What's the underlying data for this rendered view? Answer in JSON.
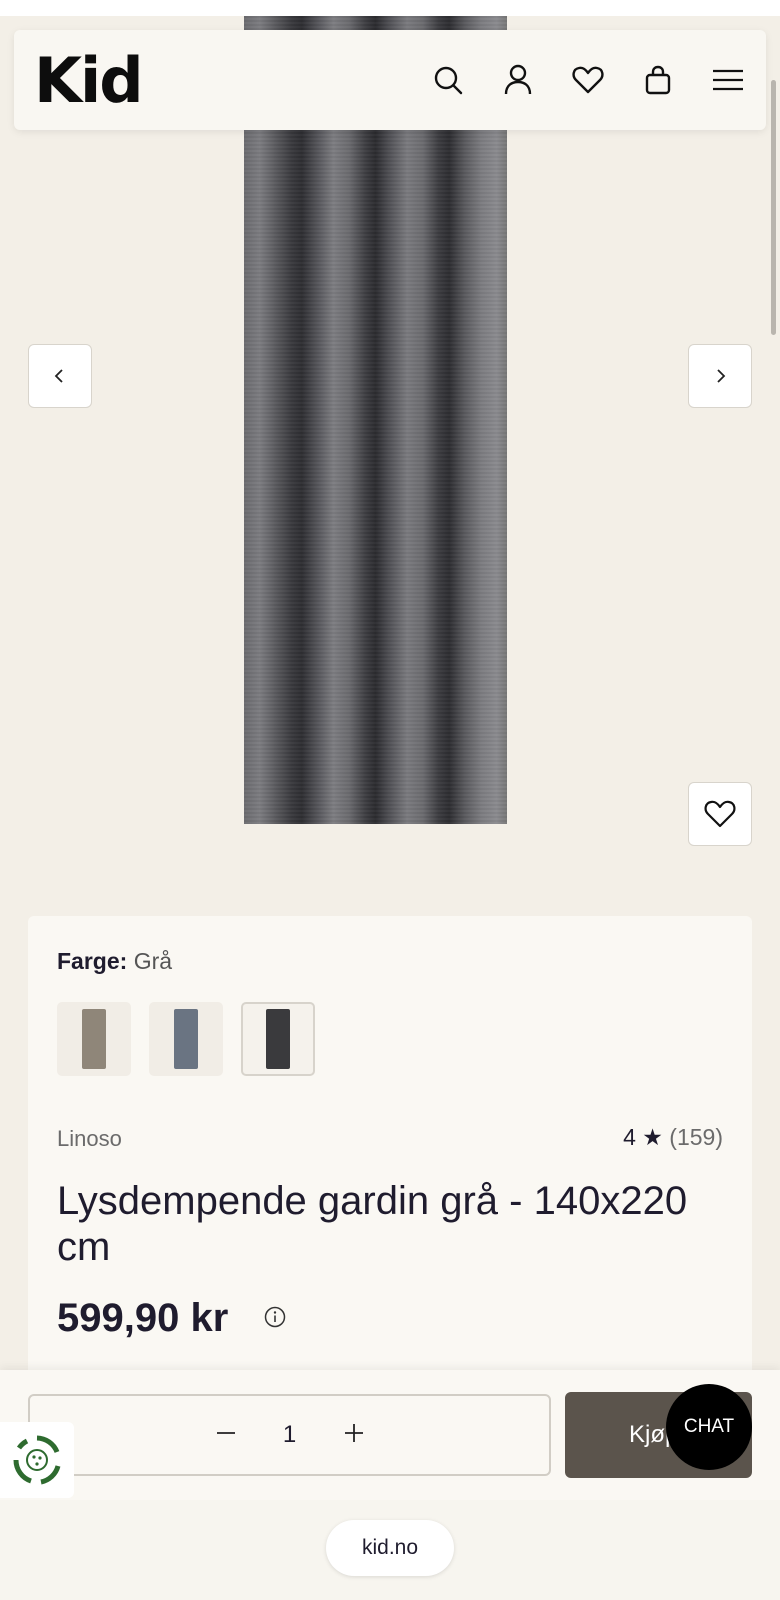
{
  "header": {
    "logo": "Kid",
    "icons": [
      "search-icon",
      "user-icon",
      "heart-icon",
      "bag-icon",
      "menu-icon"
    ]
  },
  "gallery": {
    "prev_icon": "chevron-left-icon",
    "next_icon": "chevron-right-icon",
    "favorite_icon": "heart-icon"
  },
  "product": {
    "color_label": "Farge:",
    "color_value": "Grå",
    "swatches": [
      {
        "name": "beige",
        "color": "#8f8679"
      },
      {
        "name": "blue",
        "color": "#6a7482"
      },
      {
        "name": "gray",
        "color": "#3a3a3d",
        "selected": true
      }
    ],
    "brand": "Linoso",
    "rating": "4",
    "rating_star": "★",
    "review_count": "(159)",
    "title": "Lysdempende gardin grå - 140x220 cm",
    "price": "599,90 kr"
  },
  "purchase": {
    "quantity": "1",
    "buy_label": "Kjøp",
    "chat_label": "CHAT"
  },
  "browser": {
    "url": "kid.no"
  },
  "colors": {
    "background": "#f3efe7",
    "panel": "#faf8f3",
    "buy_button": "#5b544c",
    "text": "#1f1c2e",
    "eco_green": "#2e6b2f"
  }
}
